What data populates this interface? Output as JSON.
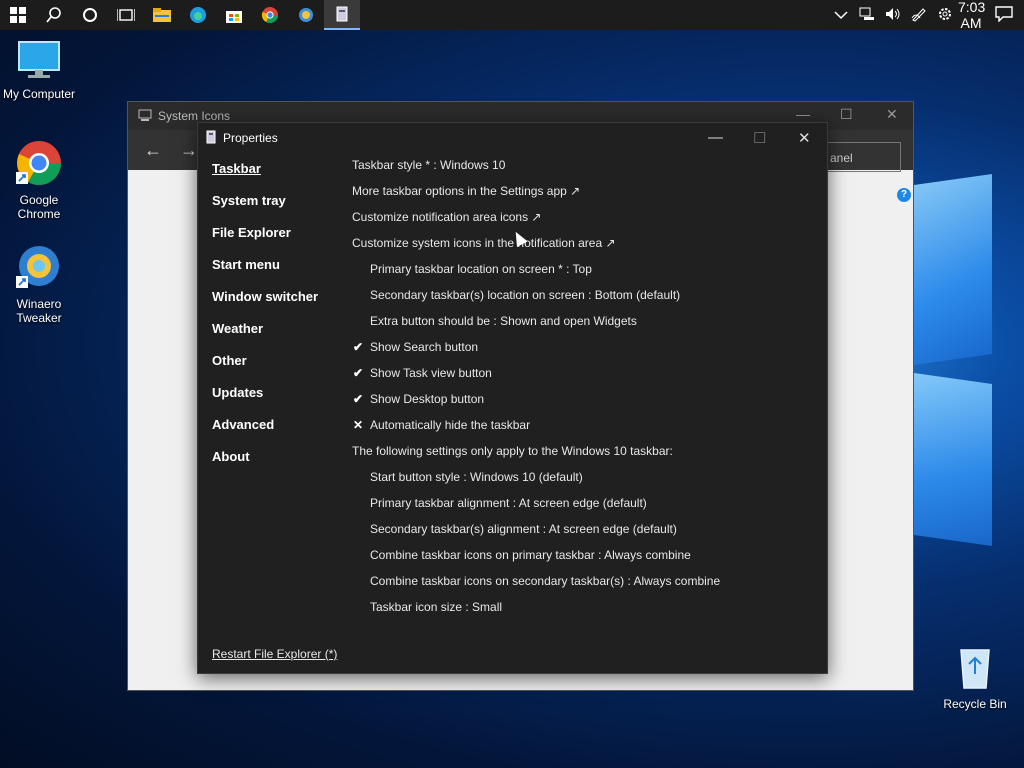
{
  "taskbar": {
    "left_icons": [
      "windows-start-icon",
      "search-icon",
      "cortana-icon",
      "task-view-icon",
      "file-explorer-icon",
      "edge-icon",
      "store-icon",
      "chrome-icon",
      "winaero-icon",
      "properties-app-icon"
    ],
    "clock": "7:03 AM",
    "tray_icons": [
      "chevron-up-icon",
      "network-icon",
      "volume-icon",
      "pen-icon",
      "settings-gear-icon"
    ],
    "notification_icon": "action-center-icon"
  },
  "desktop": {
    "icons": [
      {
        "label": "My Computer"
      },
      {
        "label": "Google\nChrome"
      },
      {
        "label": "Winaero\nTweaker"
      },
      {
        "label": "Recycle Bin"
      }
    ]
  },
  "background_window": {
    "title": "System Icons",
    "search_partial": "anel"
  },
  "dialog": {
    "title": "Properties",
    "nav": [
      "Taskbar",
      "System tray",
      "File Explorer",
      "Start menu",
      "Window switcher",
      "Weather",
      "Other",
      "Updates",
      "Advanced",
      "About"
    ],
    "selected_nav": "Taskbar",
    "options": [
      {
        "text": "Taskbar style * : Windows 10",
        "indent": 0,
        "mark": ""
      },
      {
        "text": "More taskbar options in the Settings app ↗",
        "indent": 0,
        "mark": ""
      },
      {
        "text": "Customize notification area icons ↗",
        "indent": 0,
        "mark": ""
      },
      {
        "text": "Customize system icons in the notification area ↗",
        "indent": 0,
        "mark": ""
      },
      {
        "text": "Primary taskbar location on screen * : Top",
        "indent": 1,
        "mark": ""
      },
      {
        "text": "Secondary taskbar(s) location on screen : Bottom (default)",
        "indent": 1,
        "mark": ""
      },
      {
        "text": "Extra button should be : Shown and open Widgets",
        "indent": 1,
        "mark": ""
      },
      {
        "text": "Show Search button",
        "indent": 1,
        "mark": "✔"
      },
      {
        "text": "Show Task view button",
        "indent": 1,
        "mark": "✔"
      },
      {
        "text": "Show Desktop button",
        "indent": 1,
        "mark": "✔"
      },
      {
        "text": "Automatically hide the taskbar",
        "indent": 1,
        "mark": "✕"
      },
      {
        "text": "The following settings only apply to the Windows 10 taskbar:",
        "indent": 0,
        "mark": ""
      },
      {
        "text": "Start button style : Windows 10 (default)",
        "indent": 1,
        "mark": ""
      },
      {
        "text": "Primary taskbar alignment : At screen edge (default)",
        "indent": 1,
        "mark": ""
      },
      {
        "text": "Secondary taskbar(s) alignment : At screen edge (default)",
        "indent": 1,
        "mark": ""
      },
      {
        "text": "Combine taskbar icons on primary taskbar : Always combine",
        "indent": 1,
        "mark": ""
      },
      {
        "text": "Combine taskbar icons on secondary taskbar(s) : Always combine",
        "indent": 1,
        "mark": ""
      },
      {
        "text": "Taskbar icon size : Small",
        "indent": 1,
        "mark": ""
      }
    ],
    "restart_link": "Restart File Explorer (*)"
  }
}
